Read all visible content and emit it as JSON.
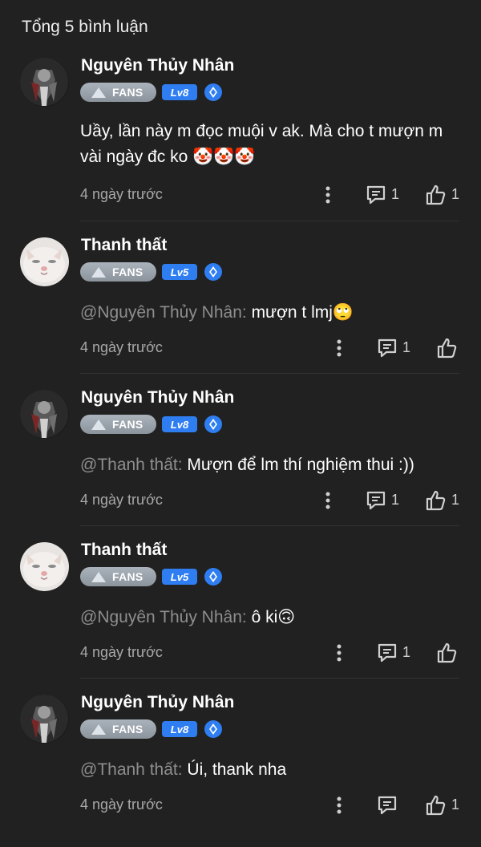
{
  "header": {
    "title": "Tổng 5 bình luận"
  },
  "badges": {
    "fans_label": "FANS"
  },
  "comments": [
    {
      "username": "Nguyên Thủy Nhân",
      "level": "Lv8",
      "mention": "",
      "text": "Uầy, lần này m đọc muội v ak. Mà cho t mượn m vài ngày đc ko 🤡🤡🤡",
      "time": "4 ngày trước",
      "reply_count": "1",
      "like_count": "1",
      "avatar": "dark-character-avatar"
    },
    {
      "username": "Thanh thất",
      "level": "Lv5",
      "mention": "@Nguyên Thủy Nhân:",
      "text": "mượn t lmj🙄",
      "time": "4 ngày trước",
      "reply_count": "1",
      "like_count": "",
      "avatar": "cat-avatar"
    },
    {
      "username": "Nguyên Thủy Nhân",
      "level": "Lv8",
      "mention": "@Thanh thất:",
      "text": "Mượn để lm thí nghiệm thui :))",
      "time": "4 ngày trước",
      "reply_count": "1",
      "like_count": "1",
      "avatar": "dark-character-avatar"
    },
    {
      "username": "Thanh thất",
      "level": "Lv5",
      "mention": "@Nguyên Thủy Nhân:",
      "text": "ô ki🙃",
      "time": "4 ngày trước",
      "reply_count": "1",
      "like_count": "",
      "avatar": "cat-avatar"
    },
    {
      "username": "Nguyên Thủy Nhân",
      "level": "Lv8",
      "mention": "@Thanh thất:",
      "text": "Úi, thank nha",
      "time": "4 ngày trước",
      "reply_count": "",
      "like_count": "1",
      "avatar": "dark-character-avatar"
    }
  ],
  "colors": {
    "background": "#212121",
    "text": "#ffffff",
    "mention": "#8e8e8e",
    "level_badge": "#2e7ef2",
    "fans_badge": "#9aa2ab"
  }
}
